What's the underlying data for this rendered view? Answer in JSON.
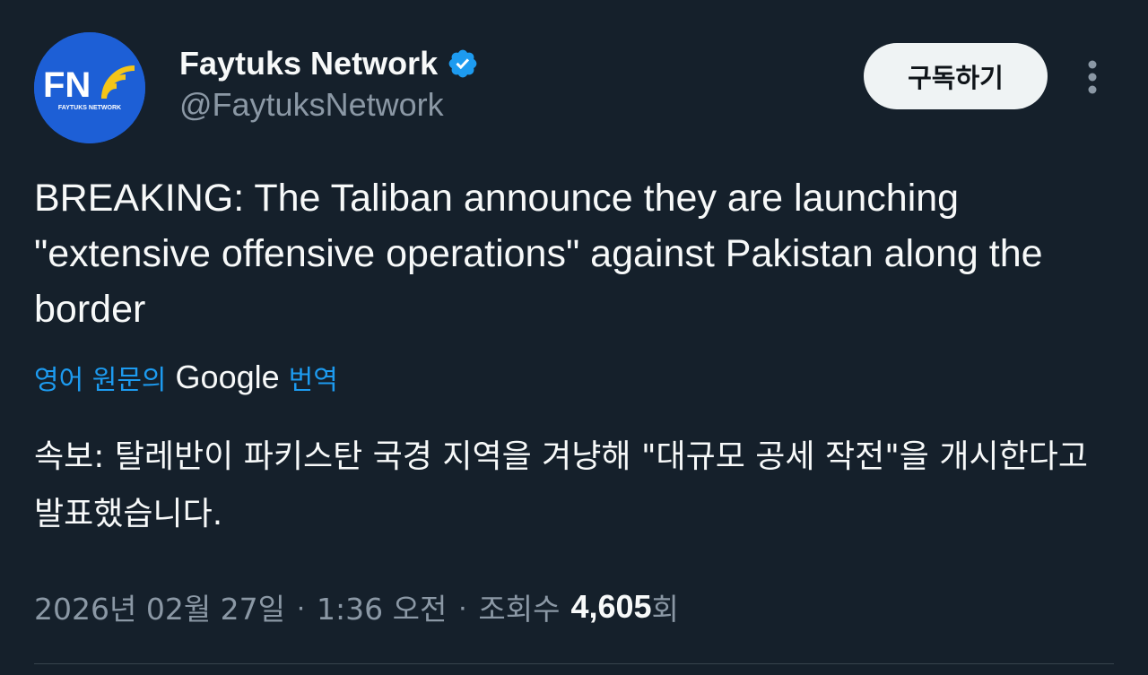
{
  "author": {
    "display_name": "Faytuks Network",
    "handle": "@FaytuksNetwork",
    "avatar_text": "FN",
    "avatar_subtext": "FAYTUKS NETWORK",
    "verified": true
  },
  "header": {
    "subscribe_label": "구독하기",
    "more_icon": "more-vertical-icon"
  },
  "tweet": {
    "text": "BREAKING: The Taliban announce they are launching \"extensive offensive operations\" against Pakistan along the border"
  },
  "translation": {
    "label": "영어 원문의",
    "provider": "Google",
    "action": "번역",
    "text": "속보: 탈레반이 파키스탄 국경 지역을 겨냥해 \"대규모 공세 작전\"을 개시한다고 발표했습니다."
  },
  "meta": {
    "date": "2026년 02월 27일",
    "separator": "·",
    "time": "1:36 오전",
    "views_label": "조회수",
    "views_count": "4,605",
    "views_unit": "회"
  },
  "colors": {
    "background": "#15202b",
    "accent": "#1d9bf0",
    "secondary_text": "#8b98a5",
    "avatar_bg": "#1d5fd6",
    "avatar_wave": "#f5c518"
  }
}
